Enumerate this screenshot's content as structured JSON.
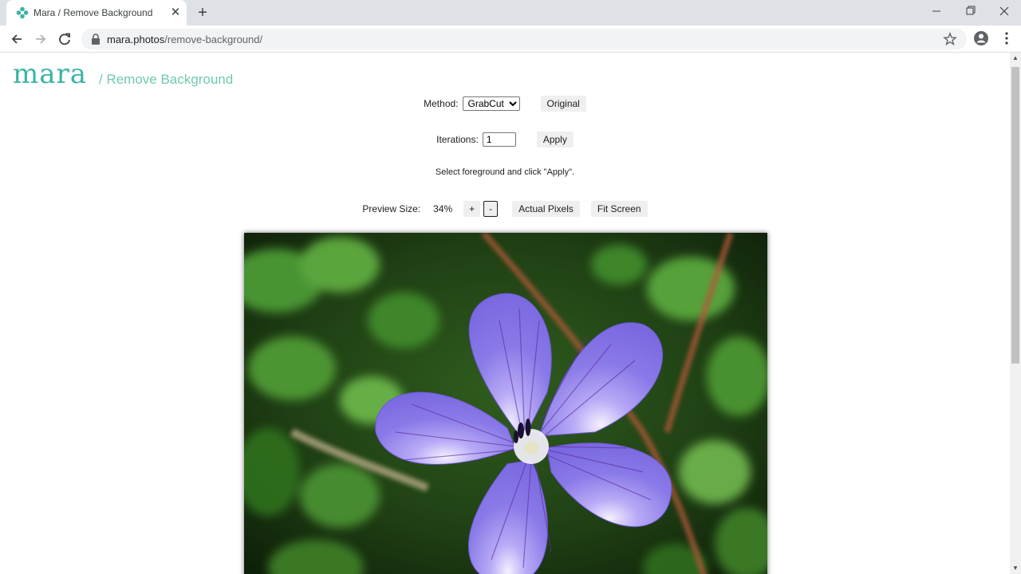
{
  "browser": {
    "tab_title": "Mara / Remove Background",
    "tab_close": "✕",
    "new_tab": "+",
    "url_domain": "mara.photos",
    "url_path": "/remove-background/"
  },
  "page": {
    "logo_text": "mara",
    "logo_subtitle": "/ Remove Background",
    "method_label": "Method:",
    "method_selected": "GrabCut",
    "original_button": "Original",
    "iterations_label": "Iterations:",
    "iterations_value": "1",
    "apply_button": "Apply",
    "instruction": "Select foreground and click \"Apply\".",
    "preview_size_label": "Preview Size:",
    "preview_size_value": "34%",
    "zoom_in": "+",
    "zoom_out": "-",
    "actual_pixels_button": "Actual Pixels",
    "fit_screen_button": "Fit Screen"
  },
  "colors": {
    "brand": "#3bb3a5",
    "petal": "#8a7ae8",
    "leaves": "#3f8f2f"
  },
  "icons": {
    "back": "arrow-left-icon",
    "forward": "arrow-right-icon",
    "reload": "reload-icon",
    "lock": "lock-icon",
    "bookmark": "star-icon",
    "profile": "account-icon",
    "menu": "kebab-menu-icon"
  }
}
